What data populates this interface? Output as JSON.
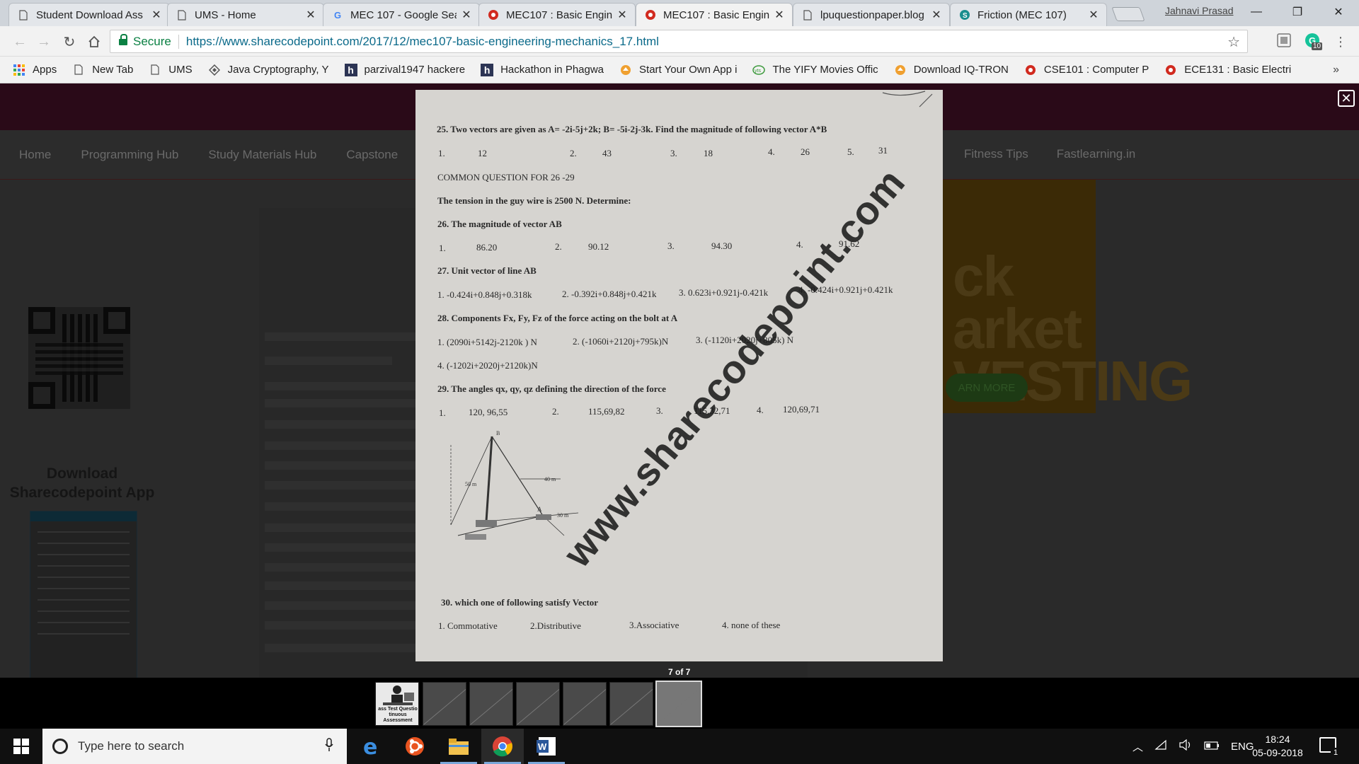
{
  "window": {
    "profile_name": "Jahnavi Prasad",
    "minimize": "—",
    "maximize": "❐",
    "close": "✕"
  },
  "tabs": [
    {
      "title": "Student Download Ass",
      "icon": "document-icon"
    },
    {
      "title": "UMS - Home",
      "icon": "document-icon"
    },
    {
      "title": "MEC 107 - Google Sea",
      "icon": "google-icon"
    },
    {
      "title": "MEC107 : Basic Engine",
      "icon": "sharecodepoint-icon"
    },
    {
      "title": "MEC107 : Basic Engine",
      "icon": "sharecodepoint-icon",
      "active": true
    },
    {
      "title": "lpuquestionpaper.blog",
      "icon": "document-icon"
    },
    {
      "title": "Friction (MEC 107)",
      "icon": "s-logo-icon"
    }
  ],
  "address": {
    "secure_label": "Secure",
    "url": "https://www.sharecodepoint.com/2017/12/mec107-basic-engineering-mechanics_17.html",
    "extension_badge": "10"
  },
  "bookmarks": [
    {
      "label": "Apps",
      "icon": "apps-grid-icon"
    },
    {
      "label": "New Tab",
      "icon": "document-icon"
    },
    {
      "label": "UMS",
      "icon": "document-icon"
    },
    {
      "label": "Java Cryptography, Y",
      "icon": "diamond-icon"
    },
    {
      "label": "parzival1947 hackere",
      "icon": "hackerearth-icon"
    },
    {
      "label": "Hackathon in Phagwa",
      "icon": "hackerearth-icon"
    },
    {
      "label": "Start Your Own App i",
      "icon": "app-icon"
    },
    {
      "label": "The YIFY Movies Offic",
      "icon": "yts-icon"
    },
    {
      "label": "Download IQ-TRON",
      "icon": "app-icon"
    },
    {
      "label": "CSE101 : Computer P",
      "icon": "sharecodepoint-icon"
    },
    {
      "label": "ECE131 : Basic Electri",
      "icon": "sharecodepoint-icon"
    }
  ],
  "bookmarks_more": "»",
  "site": {
    "nav": [
      "Home",
      "Programming Hub",
      "Study Materials Hub",
      "Capstone"
    ],
    "nav_right": [
      "Fitness Tips",
      "Fastlearning.in"
    ],
    "download_title": "Download Sharecodepoint App",
    "ad_text": "ck\narket\nVESTING",
    "ad_button": "ARN MORE"
  },
  "paper": {
    "watermark": "www.sharecodepoint.com",
    "q25": "25. Two vectors are given as A= -2i-5j+2k; B= -5i-2j-3k. Find the magnitude of following vector A*B",
    "q25_options": [
      "1.",
      "12",
      "2.",
      "43",
      "3.",
      "18",
      "4.",
      "26",
      "5.",
      "31"
    ],
    "common": "COMMON QUESTION FOR 26 -29",
    "tension": "The tension in the guy wire is 2500 N.  Determine:",
    "q26": "26. The magnitude of vector AB",
    "q26_options": [
      "1.",
      "86.20",
      "2.",
      "90.12",
      "3.",
      "94.30",
      "4.",
      "91.62"
    ],
    "q27": "27. Unit vector of  line AB",
    "q27_options": [
      "1.  -0.424i+0.848j+0.318k",
      "2.  -0.392i+0.848j+0.421k",
      "3.  0.623i+0.921j-0.421k",
      "4.  -0.424i+0.921j+0.421k"
    ],
    "q28": "28. Components Fx, Fy, Fz of the force  acting on the bolt at A",
    "q28_options": [
      "1.  (2090i+5142j-2120k ) N",
      "2. (-1060i+2120j+795k)N",
      "3. (-1120i+2020j+805k) N",
      "4. (-1202i+2020j+2120k)N"
    ],
    "q29": "29. The angles qx, qy, qz defining the direction of the force",
    "q29_options": [
      "1.",
      "120, 96,55",
      "2.",
      "115,69,82",
      "3.",
      "115,32,71",
      "4.",
      "120,69,71"
    ],
    "fig_labels": [
      "50 m",
      "40 m",
      "A",
      "30 m",
      "B"
    ],
    "q30": "30.  which one of following satisfy Vector",
    "q30_options": [
      "1. Commotative",
      "2.Distributive",
      "3.Associative",
      "4. none of these"
    ]
  },
  "lightbox": {
    "counter": "7 of 7",
    "close": "✕",
    "thumb1_text": "ass Test Questio tinuous Assessment"
  },
  "taskbar": {
    "search_placeholder": "Type here to search",
    "language": "ENG",
    "time": "18:24",
    "date": "05-09-2018",
    "notification_count": "1"
  }
}
